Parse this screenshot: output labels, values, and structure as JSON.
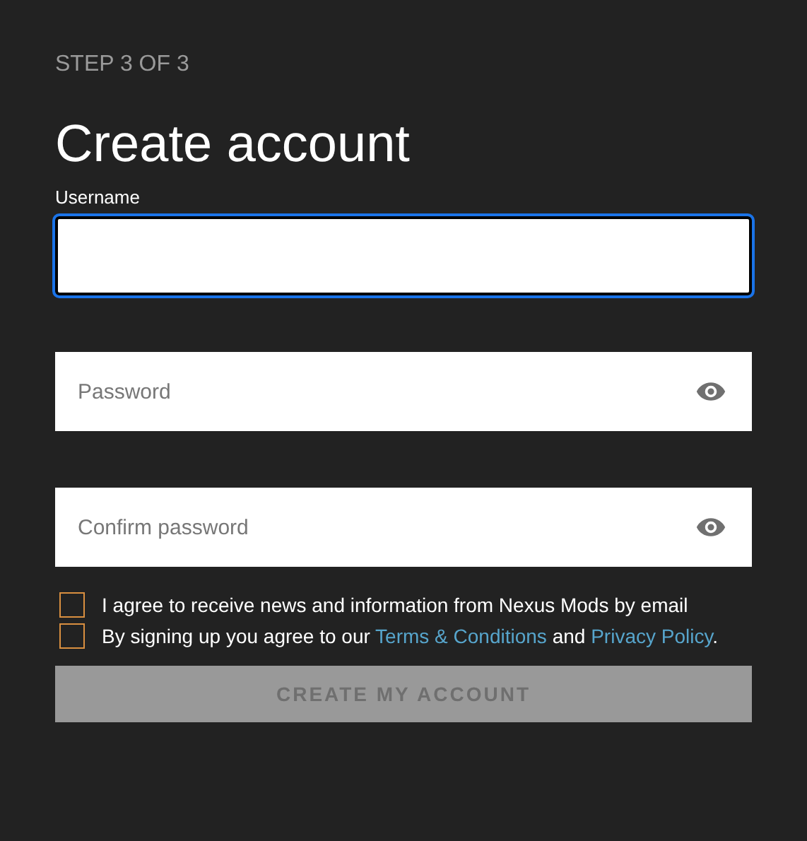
{
  "step": "STEP 3 OF 3",
  "title": "Create account",
  "fields": [
    {
      "label": "Username",
      "focused": true,
      "kind": "text"
    },
    {
      "placeholder": "Password",
      "focused": false,
      "kind": "password"
    },
    {
      "placeholder": "Confirm password",
      "focused": false,
      "kind": "password"
    }
  ],
  "checkboxes": [
    {
      "checked": false,
      "parts": [
        {
          "kind": "text",
          "text": "I agree to receive news and information from Nexus Mods by email"
        }
      ]
    },
    {
      "checked": false,
      "parts": [
        {
          "kind": "text",
          "text": "By signing up you agree to our "
        },
        {
          "kind": "link",
          "text": "Terms & Conditions"
        },
        {
          "kind": "text",
          "text": " and "
        },
        {
          "kind": "link",
          "text": "Privacy Policy"
        },
        {
          "kind": "text",
          "text": "."
        }
      ]
    }
  ],
  "submit": {
    "label": "CREATE MY ACCOUNT",
    "disabled": true
  }
}
